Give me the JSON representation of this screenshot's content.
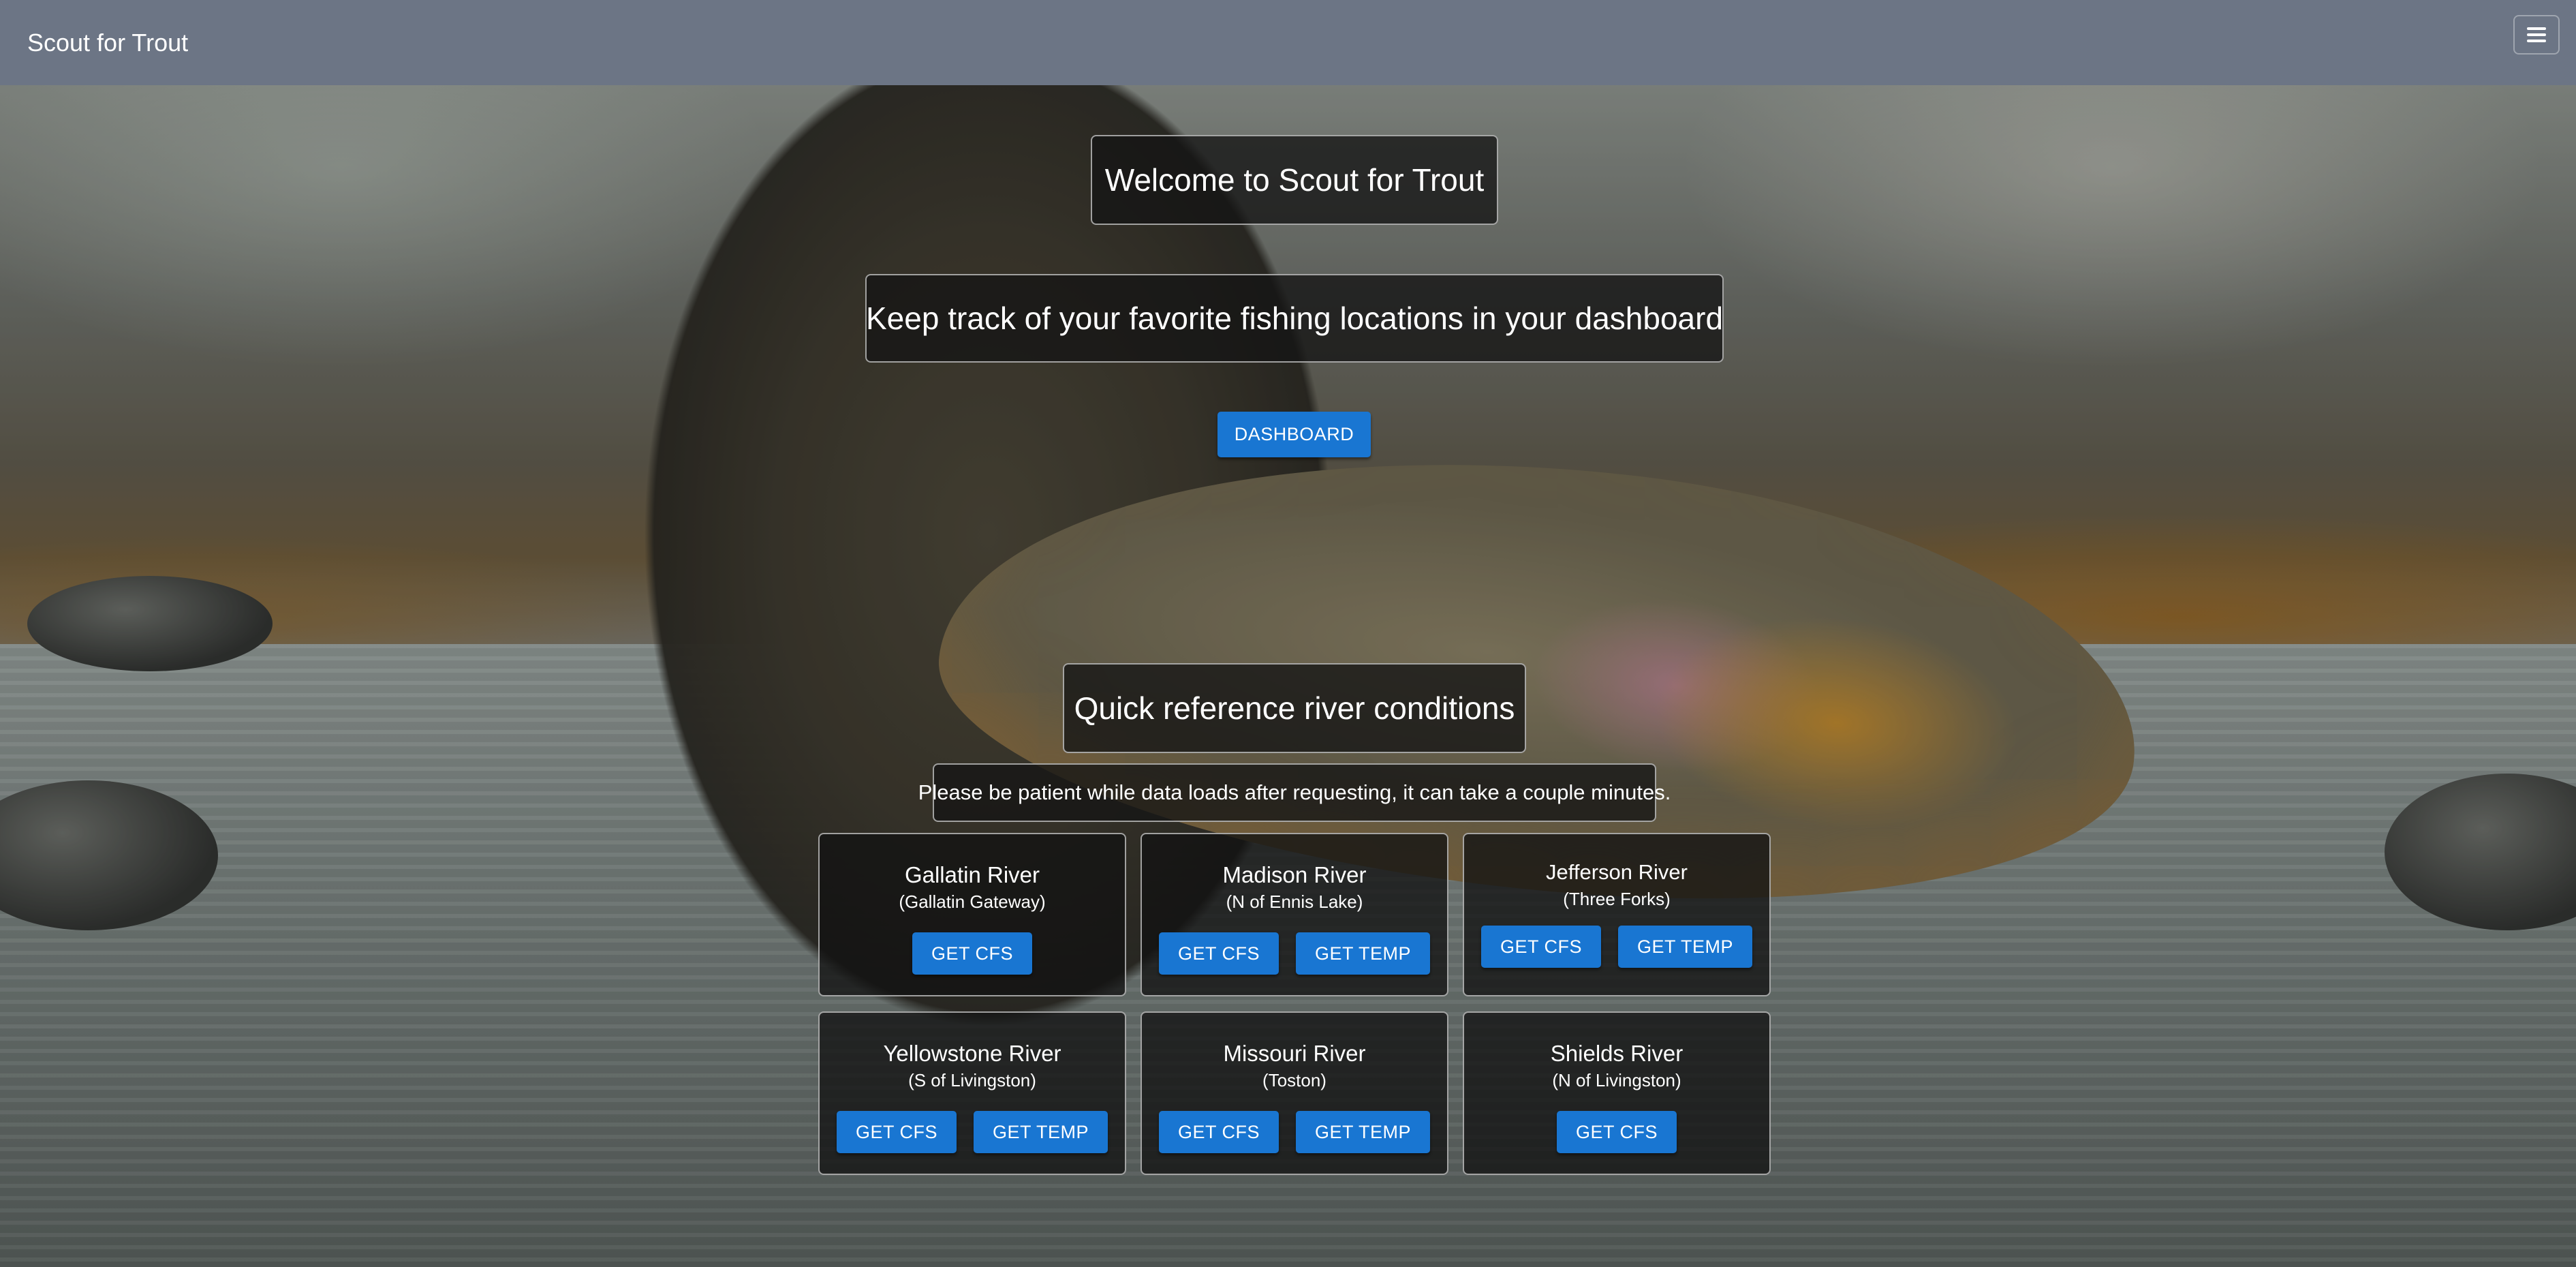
{
  "navbar": {
    "brand": "Scout for Trout",
    "menu_icon": "hamburger-menu-icon"
  },
  "hero": {
    "welcome": "Welcome to Scout for Trout",
    "tagline": "Keep track of your favorite fishing locations in your dashboard",
    "dashboard_button": "DASHBOARD"
  },
  "conditions": {
    "heading": "Quick reference river conditions",
    "note": "Please be patient while data loads after requesting, it can take a couple minutes."
  },
  "rivers": [
    {
      "name": "Gallatin River",
      "location": "(Gallatin Gateway)",
      "cfs_label": "GET CFS",
      "temp_label": ""
    },
    {
      "name": "Madison River",
      "location": "(N of Ennis Lake)",
      "cfs_label": "GET CFS",
      "temp_label": "GET TEMP"
    },
    {
      "name": "Jefferson River",
      "location": "(Three Forks)",
      "cfs_label": "GET CFS",
      "temp_label": "GET TEMP"
    },
    {
      "name": "Yellowstone River",
      "location": "(S of Livingston)",
      "cfs_label": "GET CFS",
      "temp_label": "GET TEMP"
    },
    {
      "name": "Missouri River",
      "location": "(Toston)",
      "cfs_label": "GET CFS",
      "temp_label": "GET TEMP"
    },
    {
      "name": "Shields River",
      "location": "(N of Livingston)",
      "cfs_label": "GET CFS",
      "temp_label": ""
    }
  ],
  "colors": {
    "navbar": "#6c7585",
    "button": "#1976d2"
  }
}
